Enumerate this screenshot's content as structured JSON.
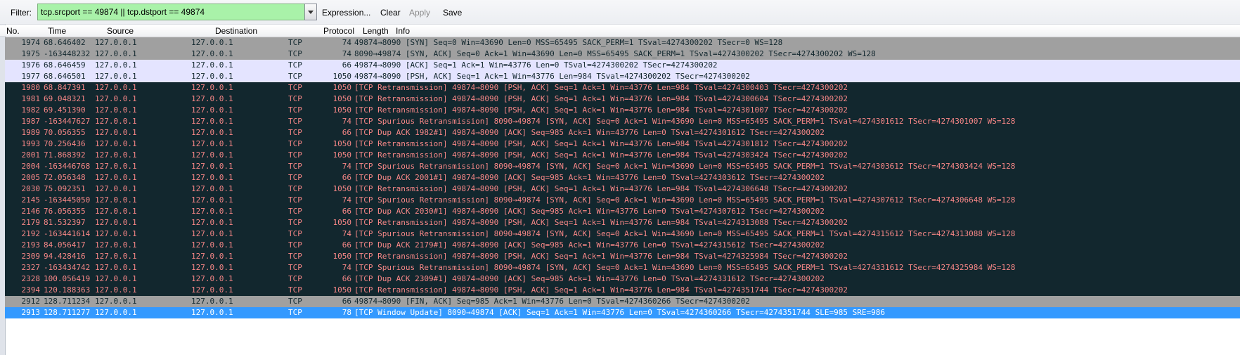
{
  "filter": {
    "label": "Filter:",
    "value": "tcp.srcport == 49874 || tcp.dstport == 49874",
    "expression_label": "Expression...",
    "clear_label": "Clear",
    "apply_label": "Apply",
    "save_label": "Save"
  },
  "columns": [
    "No.",
    "Time",
    "Source",
    "Destination",
    "Protocol",
    "Length",
    "Info"
  ],
  "colors": {
    "filter_bg": "#a9f2a9",
    "row_gray": "#a0a0a0",
    "row_lavender": "#e4e4ff",
    "row_dark": "#12272e",
    "row_dark_text": "#f78787",
    "row_selected": "#3399ff"
  },
  "packets": [
    {
      "no": "1974",
      "time": "68.646402",
      "src": "127.0.0.1",
      "dst": "127.0.0.1",
      "proto": "TCP",
      "len": "74",
      "info": "49874→8090 [SYN] Seq=0 Win=43690 Len=0 MSS=65495 SACK_PERM=1 TSval=4274300202 TSecr=0 WS=128",
      "style": "gray"
    },
    {
      "no": "1975",
      "time": "-163448232",
      "src": "127.0.0.1",
      "dst": "127.0.0.1",
      "proto": "TCP",
      "len": "74",
      "info": "8090→49874 [SYN, ACK] Seq=0 Ack=1 Win=43690 Len=0 MSS=65495 SACK_PERM=1 TSval=4274300202 TSecr=4274300202 WS=128",
      "style": "gray"
    },
    {
      "no": "1976",
      "time": "68.646459",
      "src": "127.0.0.1",
      "dst": "127.0.0.1",
      "proto": "TCP",
      "len": "66",
      "info": "49874→8090 [ACK] Seq=1 Ack=1 Win=43776 Len=0 TSval=4274300202 TSecr=4274300202",
      "style": "lav"
    },
    {
      "no": "1977",
      "time": "68.646501",
      "src": "127.0.0.1",
      "dst": "127.0.0.1",
      "proto": "TCP",
      "len": "1050",
      "info": "49874→8090 [PSH, ACK] Seq=1 Ack=1 Win=43776 Len=984 TSval=4274300202 TSecr=4274300202",
      "style": "lav"
    },
    {
      "no": "1980",
      "time": "68.847391",
      "src": "127.0.0.1",
      "dst": "127.0.0.1",
      "proto": "TCP",
      "len": "1050",
      "info": "[TCP Retransmission] 49874→8090 [PSH, ACK] Seq=1 Ack=1 Win=43776 Len=984 TSval=4274300403 TSecr=4274300202",
      "style": "dark"
    },
    {
      "no": "1981",
      "time": "69.048321",
      "src": "127.0.0.1",
      "dst": "127.0.0.1",
      "proto": "TCP",
      "len": "1050",
      "info": "[TCP Retransmission] 49874→8090 [PSH, ACK] Seq=1 Ack=1 Win=43776 Len=984 TSval=4274300604 TSecr=4274300202",
      "style": "dark"
    },
    {
      "no": "1982",
      "time": "69.451390",
      "src": "127.0.0.1",
      "dst": "127.0.0.1",
      "proto": "TCP",
      "len": "1050",
      "info": "[TCP Retransmission] 49874→8090 [PSH, ACK] Seq=1 Ack=1 Win=43776 Len=984 TSval=4274301007 TSecr=4274300202",
      "style": "dark"
    },
    {
      "no": "1987",
      "time": "-163447627",
      "src": "127.0.0.1",
      "dst": "127.0.0.1",
      "proto": "TCP",
      "len": "74",
      "info": "[TCP Spurious Retransmission] 8090→49874 [SYN, ACK] Seq=0 Ack=1 Win=43690 Len=0 MSS=65495 SACK_PERM=1 TSval=4274301612 TSecr=4274301007 WS=128",
      "style": "dark"
    },
    {
      "no": "1989",
      "time": "70.056355",
      "src": "127.0.0.1",
      "dst": "127.0.0.1",
      "proto": "TCP",
      "len": "66",
      "info": "[TCP Dup ACK 1982#1] 49874→8090 [ACK] Seq=985 Ack=1 Win=43776 Len=0 TSval=4274301612 TSecr=4274300202",
      "style": "dark"
    },
    {
      "no": "1993",
      "time": "70.256436",
      "src": "127.0.0.1",
      "dst": "127.0.0.1",
      "proto": "TCP",
      "len": "1050",
      "info": "[TCP Retransmission] 49874→8090 [PSH, ACK] Seq=1 Ack=1 Win=43776 Len=984 TSval=4274301812 TSecr=4274300202",
      "style": "dark"
    },
    {
      "no": "2001",
      "time": "71.868392",
      "src": "127.0.0.1",
      "dst": "127.0.0.1",
      "proto": "TCP",
      "len": "1050",
      "info": "[TCP Retransmission] 49874→8090 [PSH, ACK] Seq=1 Ack=1 Win=43776 Len=984 TSval=4274303424 TSecr=4274300202",
      "style": "dark"
    },
    {
      "no": "2004",
      "time": "-163446768",
      "src": "127.0.0.1",
      "dst": "127.0.0.1",
      "proto": "TCP",
      "len": "74",
      "info": "[TCP Spurious Retransmission] 8090→49874 [SYN, ACK] Seq=0 Ack=1 Win=43690 Len=0 MSS=65495 SACK_PERM=1 TSval=4274303612 TSecr=4274303424 WS=128",
      "style": "dark"
    },
    {
      "no": "2005",
      "time": "72.056348",
      "src": "127.0.0.1",
      "dst": "127.0.0.1",
      "proto": "TCP",
      "len": "66",
      "info": "[TCP Dup ACK 2001#1] 49874→8090 [ACK] Seq=985 Ack=1 Win=43776 Len=0 TSval=4274303612 TSecr=4274300202",
      "style": "dark"
    },
    {
      "no": "2030",
      "time": "75.092351",
      "src": "127.0.0.1",
      "dst": "127.0.0.1",
      "proto": "TCP",
      "len": "1050",
      "info": "[TCP Retransmission] 49874→8090 [PSH, ACK] Seq=1 Ack=1 Win=43776 Len=984 TSval=4274306648 TSecr=4274300202",
      "style": "dark"
    },
    {
      "no": "2145",
      "time": "-163445050",
      "src": "127.0.0.1",
      "dst": "127.0.0.1",
      "proto": "TCP",
      "len": "74",
      "info": "[TCP Spurious Retransmission] 8090→49874 [SYN, ACK] Seq=0 Ack=1 Win=43690 Len=0 MSS=65495 SACK_PERM=1 TSval=4274307612 TSecr=4274306648 WS=128",
      "style": "dark"
    },
    {
      "no": "2146",
      "time": "76.056355",
      "src": "127.0.0.1",
      "dst": "127.0.0.1",
      "proto": "TCP",
      "len": "66",
      "info": "[TCP Dup ACK 2030#1] 49874→8090 [ACK] Seq=985 Ack=1 Win=43776 Len=0 TSval=4274307612 TSecr=4274300202",
      "style": "dark"
    },
    {
      "no": "2179",
      "time": "81.532397",
      "src": "127.0.0.1",
      "dst": "127.0.0.1",
      "proto": "TCP",
      "len": "1050",
      "info": "[TCP Retransmission] 49874→8090 [PSH, ACK] Seq=1 Ack=1 Win=43776 Len=984 TSval=4274313088 TSecr=4274300202",
      "style": "dark"
    },
    {
      "no": "2192",
      "time": "-163441614",
      "src": "127.0.0.1",
      "dst": "127.0.0.1",
      "proto": "TCP",
      "len": "74",
      "info": "[TCP Spurious Retransmission] 8090→49874 [SYN, ACK] Seq=0 Ack=1 Win=43690 Len=0 MSS=65495 SACK_PERM=1 TSval=4274315612 TSecr=4274313088 WS=128",
      "style": "dark"
    },
    {
      "no": "2193",
      "time": "84.056417",
      "src": "127.0.0.1",
      "dst": "127.0.0.1",
      "proto": "TCP",
      "len": "66",
      "info": "[TCP Dup ACK 2179#1] 49874→8090 [ACK] Seq=985 Ack=1 Win=43776 Len=0 TSval=4274315612 TSecr=4274300202",
      "style": "dark"
    },
    {
      "no": "2309",
      "time": "94.428416",
      "src": "127.0.0.1",
      "dst": "127.0.0.1",
      "proto": "TCP",
      "len": "1050",
      "info": "[TCP Retransmission] 49874→8090 [PSH, ACK] Seq=1 Ack=1 Win=43776 Len=984 TSval=4274325984 TSecr=4274300202",
      "style": "dark"
    },
    {
      "no": "2327",
      "time": "-163434742",
      "src": "127.0.0.1",
      "dst": "127.0.0.1",
      "proto": "TCP",
      "len": "74",
      "info": "[TCP Spurious Retransmission] 8090→49874 [SYN, ACK] Seq=0 Ack=1 Win=43690 Len=0 MSS=65495 SACK_PERM=1 TSval=4274331612 TSecr=4274325984 WS=128",
      "style": "dark"
    },
    {
      "no": "2328",
      "time": "100.056419",
      "src": "127.0.0.1",
      "dst": "127.0.0.1",
      "proto": "TCP",
      "len": "66",
      "info": "[TCP Dup ACK 2309#1] 49874→8090 [ACK] Seq=985 Ack=1 Win=43776 Len=0 TSval=4274331612 TSecr=4274300202",
      "style": "dark"
    },
    {
      "no": "2394",
      "time": "120.188363",
      "src": "127.0.0.1",
      "dst": "127.0.0.1",
      "proto": "TCP",
      "len": "1050",
      "info": "[TCP Retransmission] 49874→8090 [PSH, ACK] Seq=1 Ack=1 Win=43776 Len=984 TSval=4274351744 TSecr=4274300202",
      "style": "dark"
    },
    {
      "no": "2912",
      "time": "128.711234",
      "src": "127.0.0.1",
      "dst": "127.0.0.1",
      "proto": "TCP",
      "len": "66",
      "info": "49874→8090 [FIN, ACK] Seq=985 Ack=1 Win=43776 Len=0 TSval=4274360266 TSecr=4274300202",
      "style": "gray"
    },
    {
      "no": "2913",
      "time": "128.711277",
      "src": "127.0.0.1",
      "dst": "127.0.0.1",
      "proto": "TCP",
      "len": "78",
      "info": "[TCP Window Update] 8090→49874 [ACK] Seq=1 Ack=1 Win=43776 Len=0 TSval=4274360266 TSecr=4274351744 SLE=985 SRE=986",
      "style": "sel"
    }
  ]
}
